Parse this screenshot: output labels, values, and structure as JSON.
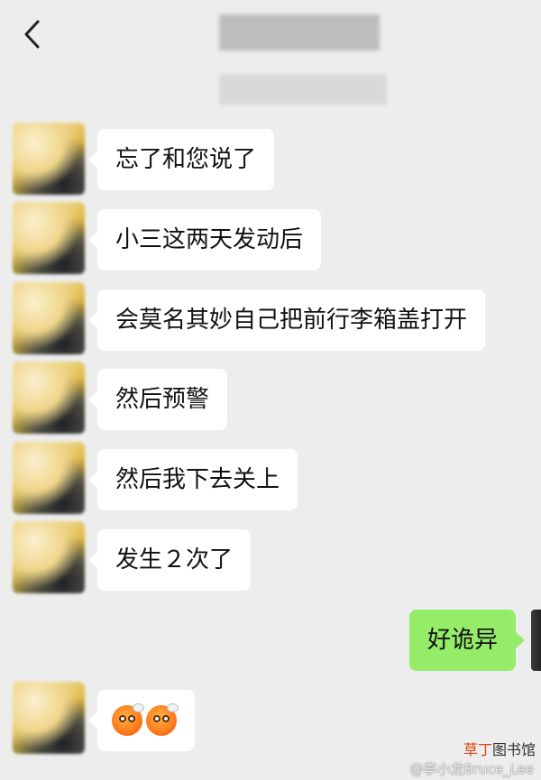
{
  "header": {
    "back_icon": "chevron-left-icon"
  },
  "messages": [
    {
      "sender": "other",
      "text": "忘了和您说了"
    },
    {
      "sender": "other",
      "text": "小三这两天发动后"
    },
    {
      "sender": "other",
      "text": "会莫名其妙自己把前行李箱盖打开"
    },
    {
      "sender": "other",
      "text": "然后预警"
    },
    {
      "sender": "other",
      "text": "然后我下去关上"
    },
    {
      "sender": "other",
      "text": "发生２次了"
    },
    {
      "sender": "me",
      "text": "好诡异"
    },
    {
      "sender": "other",
      "emojis": [
        "steaming-face-emoji",
        "steaming-face-emoji"
      ]
    }
  ],
  "watermark": {
    "brand_part1": "草丁",
    "brand_part2": "图书馆",
    "weibo": "@李小龙Bruce_Lee"
  },
  "colors": {
    "background": "#ededed",
    "bubble_other": "#ffffff",
    "bubble_me": "#95ec69",
    "brand_accent": "#d9480f"
  }
}
